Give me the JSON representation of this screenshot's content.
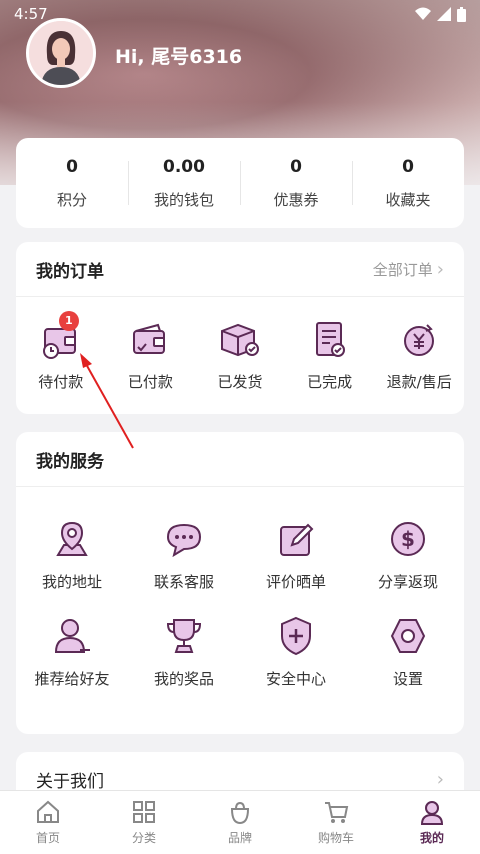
{
  "status_bar": {
    "time": "4:57"
  },
  "profile": {
    "greeting": "Hi, 尾号6316"
  },
  "stats": [
    {
      "value": "0",
      "label": "积分"
    },
    {
      "value": "0.00",
      "label": "我的钱包"
    },
    {
      "value": "0",
      "label": "优惠券"
    },
    {
      "value": "0",
      "label": "收藏夹"
    }
  ],
  "orders": {
    "title": "我的订单",
    "all_link": "全部订单",
    "items": [
      {
        "label": "待付款",
        "icon": "pending-payment-icon",
        "badge": "1"
      },
      {
        "label": "已付款",
        "icon": "paid-wallet-icon"
      },
      {
        "label": "已发货",
        "icon": "shipped-box-icon"
      },
      {
        "label": "已完成",
        "icon": "completed-document-icon"
      },
      {
        "label": "退款/售后",
        "icon": "refund-yen-icon"
      }
    ]
  },
  "services": {
    "title": "我的服务",
    "items": [
      {
        "label": "我的地址",
        "icon": "location-pin-icon"
      },
      {
        "label": "联系客服",
        "icon": "chat-bubble-icon"
      },
      {
        "label": "评价晒单",
        "icon": "edit-review-icon"
      },
      {
        "label": "分享返现",
        "icon": "dollar-coin-icon"
      },
      {
        "label": "推荐给好友",
        "icon": "user-refer-icon"
      },
      {
        "label": "我的奖品",
        "icon": "trophy-icon"
      },
      {
        "label": "安全中心",
        "icon": "shield-plus-icon"
      },
      {
        "label": "设置",
        "icon": "settings-hexagon-icon"
      }
    ]
  },
  "about": {
    "label": "关于我们"
  },
  "tabbar": [
    {
      "label": "首页",
      "icon": "home-icon",
      "active": false
    },
    {
      "label": "分类",
      "icon": "category-grid-icon",
      "active": false
    },
    {
      "label": "品牌",
      "icon": "brand-bag-icon",
      "active": false
    },
    {
      "label": "购物车",
      "icon": "cart-icon",
      "active": false
    },
    {
      "label": "我的",
      "icon": "user-profile-icon",
      "active": true
    }
  ],
  "colors": {
    "accent": "#5b2a55",
    "icon_fill": "#e8c6e8",
    "badge": "#e8403e",
    "annotation": "#e02020"
  }
}
